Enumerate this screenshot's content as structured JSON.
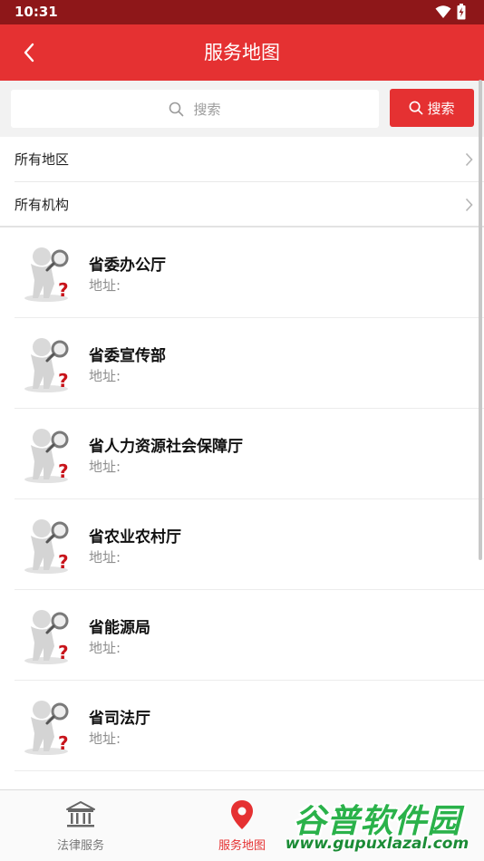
{
  "status_bar": {
    "time": "10:31",
    "icons": [
      "wifi-icon",
      "battery-charging-icon"
    ]
  },
  "app_bar": {
    "title": "服务地图",
    "back_icon": "chevron-left-icon"
  },
  "search": {
    "placeholder": "搜索",
    "button_label": "搜索"
  },
  "filters": [
    {
      "label": "所有地区"
    },
    {
      "label": "所有机构"
    }
  ],
  "organizations": [
    {
      "name": "省委办公厅",
      "address_label": "地址:"
    },
    {
      "name": "省委宣传部",
      "address_label": "地址:"
    },
    {
      "name": "省人力资源社会保障厅",
      "address_label": "地址:"
    },
    {
      "name": "省农业农村厅",
      "address_label": "地址:"
    },
    {
      "name": "省能源局",
      "address_label": "地址:"
    },
    {
      "name": "省司法厅",
      "address_label": "地址:"
    }
  ],
  "bottom_nav": {
    "items": [
      {
        "label": "法律服务",
        "icon": "courthouse-icon",
        "active": false
      },
      {
        "label": "服务地图",
        "icon": "map-pin-icon",
        "active": true
      }
    ]
  },
  "watermark": {
    "title": "谷普软件园",
    "url": "www.gupuxlazal.com"
  },
  "colors": {
    "primary": "#e53132",
    "status_bar": "#8e1719",
    "watermark": "#2ab24a"
  }
}
